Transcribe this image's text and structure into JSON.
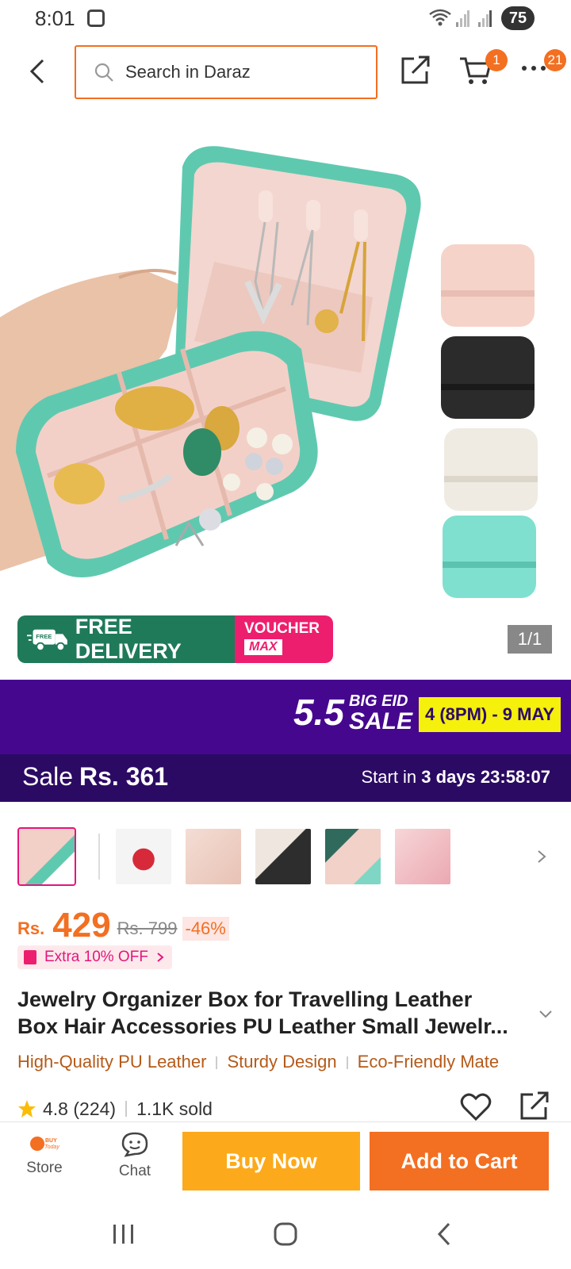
{
  "status_bar": {
    "time": "8:01",
    "battery": "75"
  },
  "header": {
    "search_placeholder": "Search in Daraz",
    "cart_count": "1",
    "more_count": "21"
  },
  "hero": {
    "free_delivery_badge": "FREE",
    "free_delivery": "FREE DELIVERY",
    "voucher_line1": "VOUCHER",
    "voucher_line2": "MAX",
    "image_counter": "1/1"
  },
  "campaign": {
    "number": "5.5",
    "big_eid": "BIG EID",
    "sale": "SALE",
    "dates": "4 (8PM) - 9 MAY"
  },
  "sale_bar": {
    "label": "Sale",
    "price": "Rs. 361",
    "start_prefix": "Start in",
    "days": "3 days",
    "countdown": "23:58:07"
  },
  "price": {
    "currency": "Rs.",
    "amount": "429",
    "original": "Rs. 799",
    "discount": "-46%"
  },
  "extra_off": "Extra 10% OFF",
  "title": {
    "line1": "Jewelry Organizer Box for Travelling Leather",
    "line2": "Box Hair Accessories PU Leather Small Jewelr..."
  },
  "features": [
    "High-Quality PU Leather",
    "Sturdy Design",
    "Eco-Friendly Mate"
  ],
  "rating": {
    "score": "4.8",
    "count": "(224)",
    "sold": "1.1K sold"
  },
  "bottom_bar": {
    "store_logo": "BUY Today",
    "store": "Store",
    "chat": "Chat",
    "buy_now": "Buy Now",
    "add_to_cart": "Add to Cart"
  },
  "colors": {
    "accent": "#f36f21",
    "buy_now": "#fcaa1b",
    "campaign_purple": "#46078f",
    "sale_purple": "#2b0a63",
    "discount_pink": "#e4167b"
  }
}
